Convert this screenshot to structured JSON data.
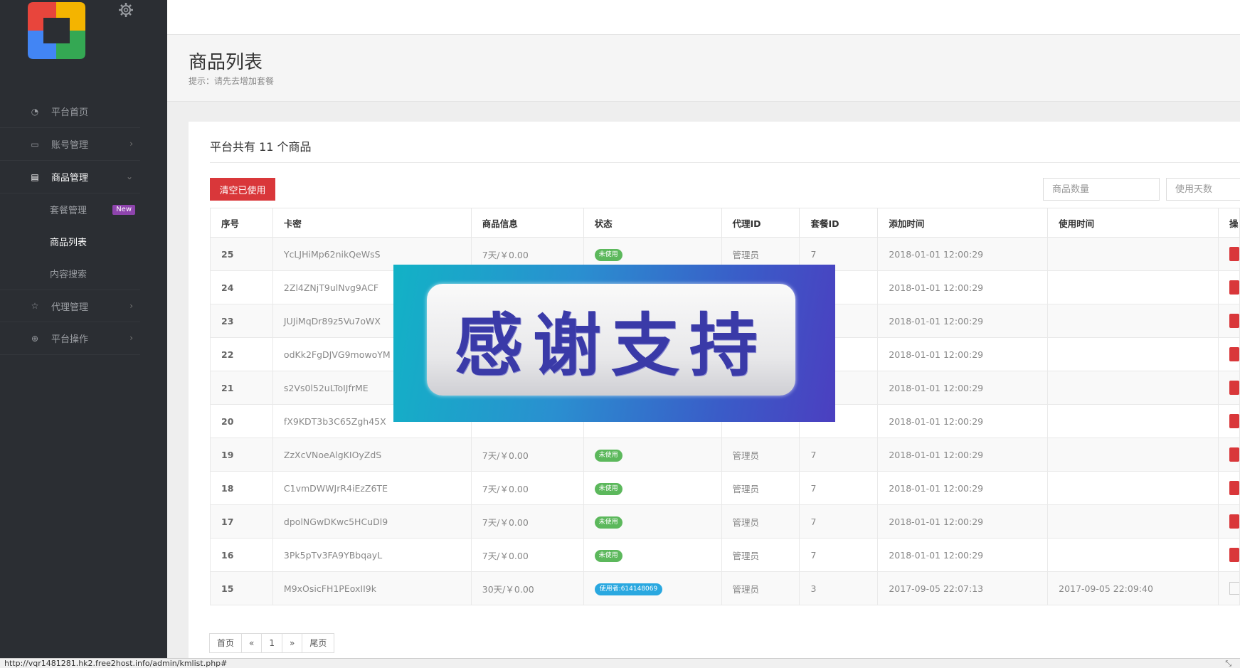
{
  "sidebar": {
    "logo_icon": "google-style-logo",
    "nav": [
      {
        "label": "平台首页",
        "icon": "dashboard-icon",
        "arrow": ""
      },
      {
        "label": "账号管理",
        "icon": "monitor-icon",
        "arrow": "›"
      },
      {
        "label": "商品管理",
        "icon": "card-icon",
        "arrow": "⌄"
      },
      {
        "label": "代理管理",
        "icon": "star-icon",
        "arrow": "›"
      },
      {
        "label": "平台操作",
        "icon": "globe-icon",
        "arrow": "›"
      }
    ],
    "sub": [
      {
        "label": "套餐管理",
        "badge": "New"
      },
      {
        "label": "商品列表",
        "badge": ""
      },
      {
        "label": "内容搜索",
        "badge": ""
      }
    ]
  },
  "header": {
    "title": "商品列表",
    "hint": "提示：请先去增加套餐"
  },
  "panel": {
    "title": "平台共有 11 个商品",
    "clear_button": "清空已使用",
    "quantity_placeholder": "商品数量",
    "days_placeholder": "使用天数"
  },
  "table": {
    "columns": [
      "序号",
      "卡密",
      "商品信息",
      "状态",
      "代理ID",
      "套餐ID",
      "添加时间",
      "使用时间",
      "操"
    ],
    "rows": [
      {
        "id": "25",
        "key": "YcLJHiMp62nikQeWsS",
        "info": "7天/￥0.00",
        "status": "未使用",
        "agent": "管理员",
        "pkg": "7",
        "added": "2018-01-01 12:00:29",
        "used": ""
      },
      {
        "id": "24",
        "key": "2Zl4ZNjT9ulNvg9ACF",
        "info": "",
        "status": "",
        "agent": "",
        "pkg": "",
        "added": "2018-01-01 12:00:29",
        "used": ""
      },
      {
        "id": "23",
        "key": "JUJiMqDr89z5Vu7oWX",
        "info": "",
        "status": "",
        "agent": "",
        "pkg": "",
        "added": "2018-01-01 12:00:29",
        "used": ""
      },
      {
        "id": "22",
        "key": "odKk2FgDJVG9mowoYM",
        "info": "",
        "status": "",
        "agent": "",
        "pkg": "",
        "added": "2018-01-01 12:00:29",
        "used": ""
      },
      {
        "id": "21",
        "key": "s2Vs0l52uLToIJfrME",
        "info": "",
        "status": "",
        "agent": "",
        "pkg": "",
        "added": "2018-01-01 12:00:29",
        "used": ""
      },
      {
        "id": "20",
        "key": "fX9KDT3b3C65Zgh45X",
        "info": "",
        "status": "",
        "agent": "",
        "pkg": "",
        "added": "2018-01-01 12:00:29",
        "used": ""
      },
      {
        "id": "19",
        "key": "ZzXcVNoeAlgKIOyZdS",
        "info": "7天/￥0.00",
        "status": "未使用",
        "agent": "管理员",
        "pkg": "7",
        "added": "2018-01-01 12:00:29",
        "used": ""
      },
      {
        "id": "18",
        "key": "C1vmDWWJrR4iEzZ6TE",
        "info": "7天/￥0.00",
        "status": "未使用",
        "agent": "管理员",
        "pkg": "7",
        "added": "2018-01-01 12:00:29",
        "used": ""
      },
      {
        "id": "17",
        "key": "dpolNGwDKwc5HCuDl9",
        "info": "7天/￥0.00",
        "status": "未使用",
        "agent": "管理员",
        "pkg": "7",
        "added": "2018-01-01 12:00:29",
        "used": ""
      },
      {
        "id": "16",
        "key": "3Pk5pTv3FA9YBbqayL",
        "info": "7天/￥0.00",
        "status": "未使用",
        "agent": "管理员",
        "pkg": "7",
        "added": "2018-01-01 12:00:29",
        "used": ""
      },
      {
        "id": "15",
        "key": "M9xOsicFH1PEoxII9k",
        "info": "30天/￥0.00",
        "status": "使用者:614148069",
        "agent": "管理员",
        "pkg": "3",
        "added": "2017-09-05 22:07:13",
        "used": "2017-09-05 22:09:40"
      }
    ]
  },
  "pager": [
    "首页",
    "«",
    "1",
    "»",
    "尾页"
  ],
  "overlay": {
    "text": "感谢支持"
  },
  "statusbar": {
    "url": "http://vqr1481281.hk2.free2host.info/admin/kmlist.php#"
  },
  "colors": {
    "sidebar": "#2b2e33",
    "danger": "#d9373a",
    "success": "#5cb85c",
    "info": "#2aa8e0",
    "badge": "#8e44ad"
  }
}
